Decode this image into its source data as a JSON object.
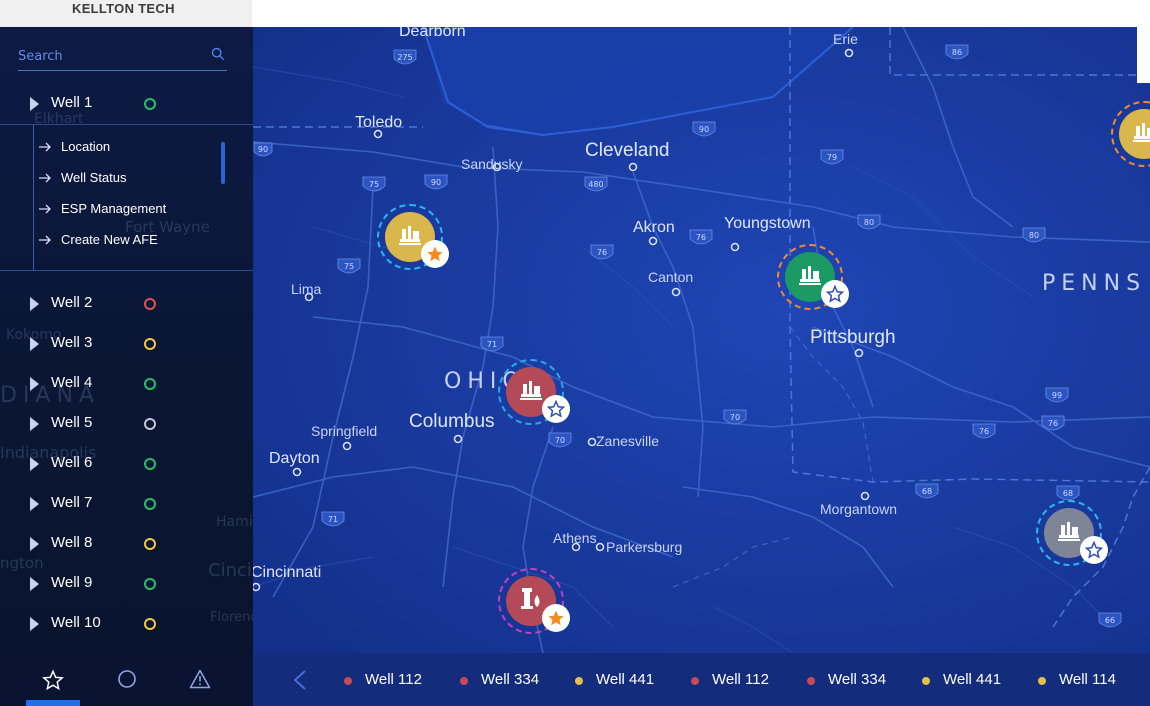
{
  "app": {
    "logo_text": "KELLTON TECH"
  },
  "sidebar": {
    "search_placeholder": "Search",
    "expanded_well": {
      "name": "Well 1",
      "status_color": "#1fc46a",
      "submenu": [
        "Location",
        "Well Status",
        "ESP Management",
        "Create New AFE"
      ]
    },
    "wells": [
      {
        "name": "Well 2",
        "status_color": "#e0524f"
      },
      {
        "name": "Well 3",
        "status_color": "#f2c93b"
      },
      {
        "name": "Well 4",
        "status_color": "#1fc46a"
      },
      {
        "name": "Well 5",
        "status_color": "#c4c7cf"
      },
      {
        "name": "Well 6",
        "status_color": "#1fc46a"
      },
      {
        "name": "Well 7",
        "status_color": "#1fc46a"
      },
      {
        "name": "Well 8",
        "status_color": "#f2c93b"
      },
      {
        "name": "Well 9",
        "status_color": "#1fc46a"
      },
      {
        "name": "Well 10",
        "status_color": "#f2c93b"
      }
    ],
    "background_map_labels": [
      "Elkhart",
      "Fort Wayne",
      "Kokomo",
      "DIANA",
      "Indianapolis",
      "Hamilton",
      "Cincinnati",
      "Florence",
      "ngton"
    ],
    "footer_tabs": [
      {
        "name": "favorites",
        "icon": "star-icon",
        "active": true
      },
      {
        "name": "all",
        "icon": "circle-icon",
        "active": false
      },
      {
        "name": "alerts",
        "icon": "warning-icon",
        "active": false
      }
    ]
  },
  "map": {
    "cities": [
      "Dearborn",
      "Toledo",
      "Sandusky",
      "Cleveland",
      "Erie",
      "Akron",
      "Youngstown",
      "Canton",
      "Lima",
      "Pittsburgh",
      "Springfield",
      "Columbus",
      "Zanesville",
      "Dayton",
      "Morgantown",
      "Athens",
      "Parkersburg",
      "Hamilton",
      "Cincinnati",
      "Florence"
    ],
    "regions": [
      "OHIO",
      "PENNS"
    ],
    "highways": [
      "275",
      "90",
      "75",
      "90",
      "80",
      "480",
      "90",
      "79",
      "86",
      "80",
      "76",
      "75",
      "71",
      "80",
      "70",
      "70",
      "76",
      "76",
      "99",
      "68",
      "71",
      "68",
      "66",
      "71"
    ],
    "markers": [
      {
        "name": "marker-yellow-toledo",
        "color": "#d9b74c",
        "ring": "#29b7f0",
        "starred": true
      },
      {
        "name": "marker-green-youngstown",
        "color": "#1b9b63",
        "ring": "#f08a2c",
        "starred": false
      },
      {
        "name": "marker-red-columbus",
        "color": "#b44a58",
        "ring": "#2aa7e8",
        "starred": false
      },
      {
        "name": "marker-red-athens",
        "color": "#b44a58",
        "ring": "#c040c0",
        "starred": true
      },
      {
        "name": "marker-grey-east",
        "color": "#7d8596",
        "ring": "#29b7f0",
        "starred": false
      },
      {
        "name": "marker-yellow-edge",
        "color": "#d9b74c",
        "ring": "#f08a2c",
        "starred": false
      }
    ],
    "colors": {
      "star_fill": "#f28c1e",
      "star_outline": "#2e4fb0"
    }
  },
  "ticker": {
    "items": [
      {
        "label": "Well 112",
        "color": "#c74a5a"
      },
      {
        "label": "Well 334",
        "color": "#c74a5a"
      },
      {
        "label": "Well 441",
        "color": "#e2c14a"
      },
      {
        "label": "Well 112",
        "color": "#c74a5a"
      },
      {
        "label": "Well 334",
        "color": "#c74a5a"
      },
      {
        "label": "Well 441",
        "color": "#e2c14a"
      },
      {
        "label": "Well 114",
        "color": "#e2c14a"
      }
    ]
  }
}
